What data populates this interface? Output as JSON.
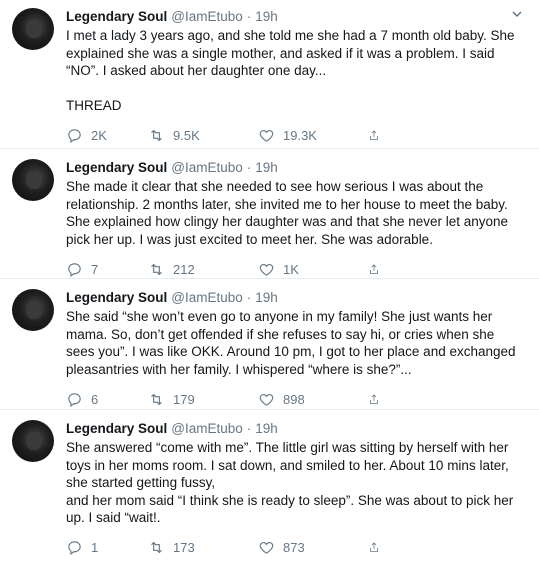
{
  "tweets": [
    {
      "author": "Legendary Soul",
      "handle": "@IamEtubo",
      "time": "19h",
      "text": "I met a lady 3 years ago, and she told me she had a 7 month old baby. She explained she was a single mother, and asked if it was a problem. I said “NO”. I asked about her daughter one day...\n\nTHREAD",
      "replies": "2K",
      "retweets": "9.5K",
      "likes": "19.3K"
    },
    {
      "author": "Legendary Soul",
      "handle": "@IamEtubo",
      "time": "19h",
      "text": "She made it clear that she needed to see how serious I was about the relationship. 2 months later, she invited me to her house to meet the baby. She explained how clingy her daughter was and that she never let anyone pick her up. I was just excited to meet her. She was adorable.",
      "replies": "7",
      "retweets": "212",
      "likes": "1K"
    },
    {
      "author": "Legendary Soul",
      "handle": "@IamEtubo",
      "time": "19h",
      "text": "She said “she won’t even go to anyone in my family! She just wants her mama. So, don’t get offended if she refuses to say hi, or cries when she sees you”. I was like OKK. Around 10 pm, I got to her place and exchanged pleasantries with her family. I whispered “where is she?”...",
      "replies": "6",
      "retweets": "179",
      "likes": "898"
    },
    {
      "author": "Legendary Soul",
      "handle": "@IamEtubo",
      "time": "19h",
      "text": "She answered “come with me”. The little girl was sitting by herself with her toys in her moms room. I sat down, and smiled to her. About 10 mins later, she started getting fussy,\nand her mom said “I think she is ready to sleep”. She was about to pick her up. I said “wait!.",
      "replies": "1",
      "retweets": "173",
      "likes": "873"
    }
  ],
  "separator": "·",
  "icons": {
    "reply": "reply-icon",
    "retweet": "retweet-icon",
    "like": "heart-icon",
    "share": "share-icon",
    "menu": "chevron-down-icon"
  },
  "colors": {
    "text": "#14171a",
    "muted": "#657786",
    "border": "#e6ecf0"
  }
}
